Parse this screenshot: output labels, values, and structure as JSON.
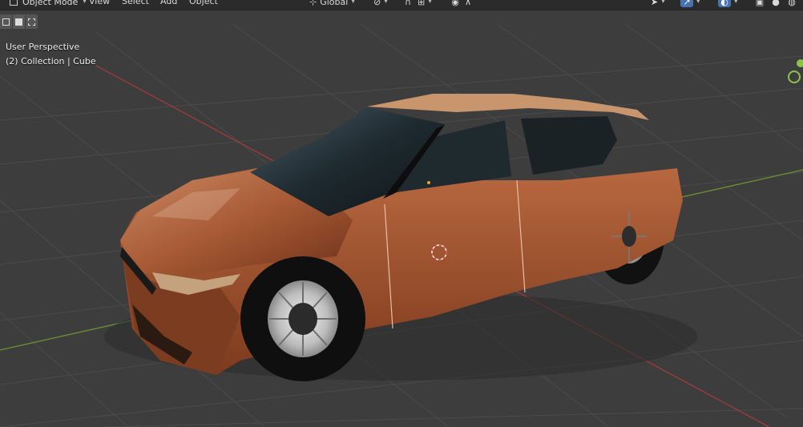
{
  "header": {
    "mode": "Object Mode",
    "menus": [
      "View",
      "Select",
      "Add",
      "Object"
    ],
    "orientation": "Global"
  },
  "viewport": {
    "view_name": "User Perspective",
    "collection_info": "(2) Collection | Cube"
  },
  "icons": {
    "mode": "object-mode-icon",
    "orientation": "transform-orientation-icon",
    "pivot": "pivot-point-icon",
    "snap": "snap-icon",
    "proportional": "proportional-editing-icon",
    "gizmo": "gizmo-icon",
    "overlay": "overlay-icon",
    "xray": "xray-icon",
    "shading": "solid-shading-icon"
  },
  "colors": {
    "background": "#3d3d3d",
    "header": "#2b2b2b",
    "active": "#4772b3",
    "car_body": "#b0603a",
    "x_axis": "#b23b3b",
    "y_axis": "#7a9a3a",
    "y_gizmo": "#8bc34a"
  }
}
